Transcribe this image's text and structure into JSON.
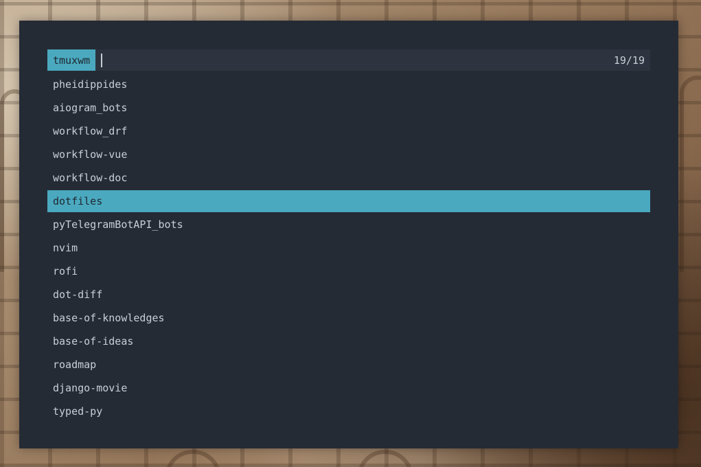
{
  "search": {
    "prompt": "tmuxwm",
    "value": "",
    "counter": "19/19"
  },
  "items": [
    {
      "label": "pheidippides",
      "selected": false
    },
    {
      "label": "aiogram_bots",
      "selected": false
    },
    {
      "label": "workflow_drf",
      "selected": false
    },
    {
      "label": "workflow-vue",
      "selected": false
    },
    {
      "label": "workflow-doc",
      "selected": false
    },
    {
      "label": "dotfiles",
      "selected": true
    },
    {
      "label": "pyTelegramBotAPI_bots",
      "selected": false
    },
    {
      "label": "nvim",
      "selected": false
    },
    {
      "label": "rofi",
      "selected": false
    },
    {
      "label": "dot-diff",
      "selected": false
    },
    {
      "label": "base-of-knowledges",
      "selected": false
    },
    {
      "label": "base-of-ideas",
      "selected": false
    },
    {
      "label": "roadmap",
      "selected": false
    },
    {
      "label": "django-movie",
      "selected": false
    },
    {
      "label": "typed-py",
      "selected": false
    }
  ],
  "colors": {
    "panel": "#252b35",
    "input_bg": "#2d343f",
    "accent": "#4aa9bf",
    "text": "#c9ced6",
    "selected_text": "#1f2630"
  }
}
